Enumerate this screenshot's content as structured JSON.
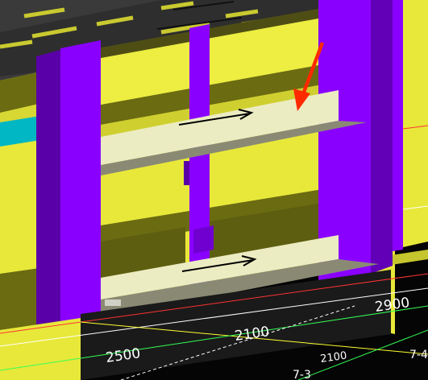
{
  "viewport": {
    "kind": "3d-model-view",
    "colors": {
      "background": "#050505",
      "upper_background": "#3a3a3a",
      "wall_yellow": "#e8e83a",
      "wall_yellow_shadow": "#6b6b12",
      "column_purple": "#8a00ff",
      "ledge_light": "#ececc2",
      "ledge_shadow": "#8a8a74",
      "cyan_band": "#00b7c3",
      "annotation_arrow_red": "#ff2a00",
      "direction_arrow": "#000000",
      "gridline_white": "#ffffff",
      "gridline_green": "#33ff55",
      "gridline_yellow": "#ffff33",
      "gridline_red": "#ff3333"
    }
  },
  "annotations": {
    "red_arrow": "annotation-arrow-red",
    "direction_arrows": [
      "direction-arrow-upper",
      "direction-arrow-lower"
    ]
  },
  "dimensions": [
    {
      "id": "dim-2500",
      "text": "2500"
    },
    {
      "id": "dim-2100",
      "text": "2100"
    },
    {
      "id": "dim-2900",
      "text": "2900"
    },
    {
      "id": "dim-2100-small",
      "text": "2100"
    }
  ],
  "axis_labels": [
    {
      "id": "axis-7-3",
      "text": "7-3"
    },
    {
      "id": "axis-7-4",
      "text": "7-4"
    }
  ]
}
